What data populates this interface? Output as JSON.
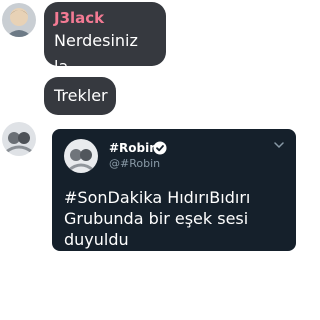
{
  "messages": [
    {
      "username": "J3lack",
      "text": "Nerdesiniz la"
    },
    {
      "text": "Trekler"
    }
  ],
  "tweet": {
    "name": "#Robin",
    "handle": "@#Robin",
    "text": "#SonDakika HıdırıBıdırı\nGrubunda bir eşek sesi\nduyuldu",
    "verified": true
  },
  "icons": {
    "verified": "verified-badge-icon",
    "chevron": "chevron-down-icon"
  },
  "colors": {
    "bubble": "#36393f",
    "username": "#f27a93",
    "tweet_bg": "#15202b",
    "handle": "#8899a6"
  }
}
